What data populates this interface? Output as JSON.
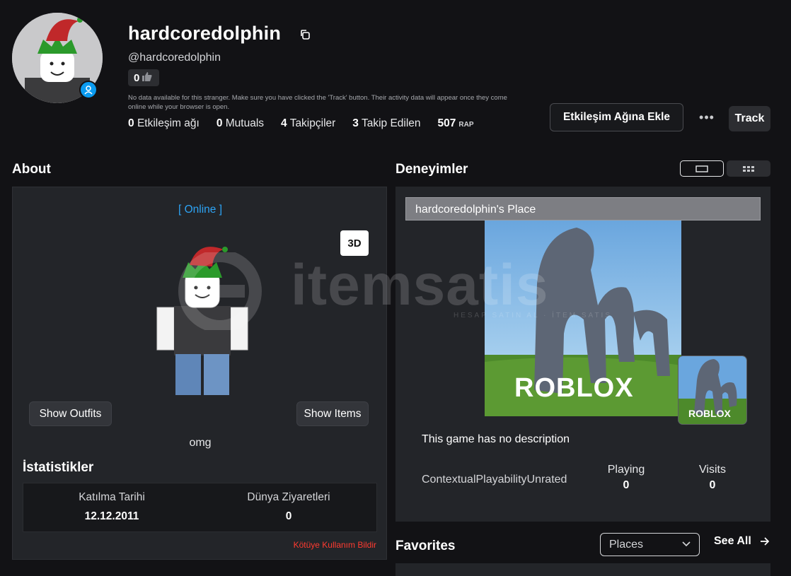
{
  "profile": {
    "display_name": "hardcoredolphin",
    "handle": "@hardcoredolphin",
    "likes": "0",
    "note": "No data available for this stranger. Make sure you have clicked the 'Track' button. Their activity data will appear once they come online while your browser is open.",
    "stats": [
      {
        "value": "0",
        "label": "Etkileşim ağı"
      },
      {
        "value": "0",
        "label": "Mutuals"
      },
      {
        "value": "4",
        "label": "Takipçiler"
      },
      {
        "value": "3",
        "label": "Takip Edilen"
      }
    ],
    "rap_value": "507",
    "rap_label": "RAP"
  },
  "actions": {
    "add_network": "Etkileşim Ağına Ekle",
    "more": "•••",
    "track": "Track"
  },
  "about": {
    "heading": "About",
    "status": "[ Online ]",
    "btn_3d": "3D",
    "show_outfits": "Show Outfits",
    "show_items": "Show Items",
    "bio": "omg",
    "stats_heading": "İstatistikler",
    "join_label": "Katılma Tarihi",
    "join_value": "12.12.2011",
    "visits_label": "Dünya Ziyaretleri",
    "visits_value": "0",
    "report": "Kötüye Kullanım Bildir"
  },
  "experiences": {
    "heading": "Deneyimler",
    "place_title": "hardcoredolphin's Place",
    "logo_text": "ROBLOX",
    "description": "This game has no description",
    "rating": "ContextualPlayabilityUnrated",
    "playing_label": "Playing",
    "playing_value": "0",
    "visits_label": "Visits",
    "visits_value": "0"
  },
  "favorites": {
    "heading": "Favorites",
    "filter_value": "Places",
    "see_all": "See All"
  },
  "watermark": {
    "text": "itemsatis",
    "sub": "HESAP SATIN AL · İTEM SATIŞ"
  },
  "colors": {
    "background": "#121215",
    "panel": "#232529",
    "online": "#2da4f5",
    "report": "#ff3b30",
    "badge": "#0a9bf0"
  }
}
